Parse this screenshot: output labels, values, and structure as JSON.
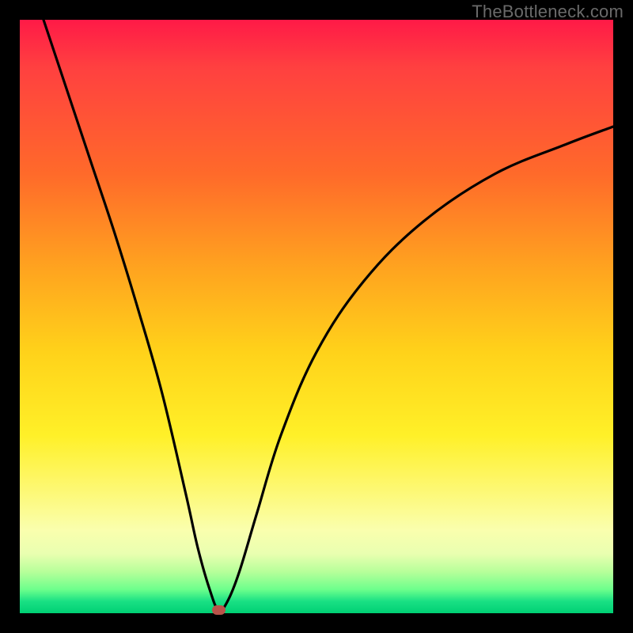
{
  "watermark": "TheBottleneck.com",
  "colors": {
    "frame": "#000000",
    "watermark_text": "#6a6a6a",
    "curve": "#000000",
    "marker": "#b9534a",
    "gradient_top": "#ff1a47",
    "gradient_bottom": "#00d074"
  },
  "chart_data": {
    "type": "line",
    "title": "",
    "xlabel": "",
    "ylabel": "",
    "xlim": [
      0,
      100
    ],
    "ylim": [
      0,
      100
    ],
    "grid": false,
    "legend": null,
    "series": [
      {
        "name": "bottleneck-curve",
        "x": [
          4,
          8,
          12,
          16,
          20,
          24,
          28,
          30,
          32,
          33.5,
          35,
          37,
          40,
          44,
          50,
          58,
          68,
          80,
          92,
          100
        ],
        "y": [
          100,
          88,
          76,
          64,
          51,
          37,
          20,
          11,
          4,
          0.5,
          2,
          7,
          17,
          30,
          44,
          56,
          66,
          74,
          79,
          82
        ]
      }
    ],
    "minimum_marker": {
      "x": 33.5,
      "y": 0.5
    },
    "note": "x and y in percent of plot area; y=0 is the green bottom edge, y=100 is the red top edge."
  }
}
